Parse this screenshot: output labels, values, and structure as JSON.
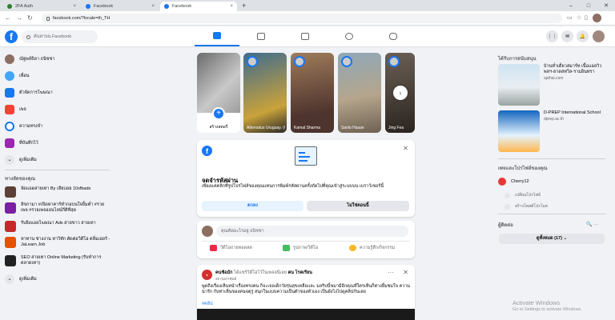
{
  "browser": {
    "tabs": [
      {
        "label": "2FA Auth"
      },
      {
        "label": "Facebook"
      },
      {
        "label": "Facebook"
      }
    ],
    "url": "facebook.com/?locale=th_TH",
    "new_tab": "+",
    "close": "×",
    "back": "←",
    "forward": "→",
    "reload": "↻",
    "minimize": "–",
    "maximize": "□",
    "win_close": "✕"
  },
  "header": {
    "logo": "f",
    "search_placeholder": "ค้นหาบน Facebook",
    "menu_icon": "⋮⋮",
    "messenger_icon": "✉",
    "bell_icon": "🔔"
  },
  "sidebar": {
    "items": [
      {
        "label": "ณัฐพล์ธิดา ธนิชชา"
      },
      {
        "label": "เพื่อน"
      },
      {
        "label": "ตัวจัดการโฆษณา"
      },
      {
        "label": "เพจ"
      },
      {
        "label": "ความทรงจำ"
      },
      {
        "label": "ที่บันทึกไว้"
      },
      {
        "label": "ดูเพิ่มเติม"
      }
    ],
    "shortcuts_title": "ทางลัดของคุณ",
    "shortcuts": [
      {
        "label": "จัดแอดสายเทา By เฮียบอย 10xfbads"
      },
      {
        "label": "ลิขกามา #เปิดหาคาร์ทำกอบนใจยิ้มต่ำ #รวยเพจ #รวยเพจออนไลน์กี่ดีที่สุด"
      },
      {
        "label": "รับยิงแอดโฆษณา Ads สายขาว สายเทา"
      },
      {
        "label": "หาทาน ช่างงาน หาวิทัก ตัดต่อวิดีโอ ตลิ่มเอยร์ - JaLearn Job"
      },
      {
        "label": "SEO สายเทา Online Marketing (รับทำการตลาดเทา)"
      },
      {
        "label": "ดูเพิ่มเติม"
      }
    ]
  },
  "stories": [
    {
      "label": "สร้างสตอรี่"
    },
    {
      "label": "Alternatus Uruguay. (Ciudad..."
    },
    {
      "label": "Kamal Sharma"
    },
    {
      "label": "Sanlo Hasan"
    },
    {
      "label": "Jing Fea"
    }
  ],
  "password_card": {
    "title": "จดจำรหัสผ่าน",
    "desc": "เพียงแค่คลิกที่รูปโปรไฟล์ของคุณแทนการพิมพ์รหัสผ่านครั้งถัดไปที่คุณเข้าสู่ระบบบน เบราว์เซอร์นี้",
    "ok": "ตกลง",
    "not_now": "ไม่ใช่ตอนนี้"
  },
  "composer": {
    "placeholder": "คุณคิดอะไรอยู่ ธนิชชา",
    "live": "วิดีโอถ่ายทอดสด",
    "photo": "รูปภาพ/วิดีโอ",
    "feeling": "ความรู้สึก/กิจกรรม"
  },
  "post": {
    "author": "คนซ้อมัก",
    "with_text": "ได้แชร์วิดีโอไว้ในเพจอนีเลย",
    "partner": "คน โรคเรียน",
    "time": "29 กุมภาพันธ์ ·",
    "more": "···",
    "text": "พูดถึงเรื่องเห็นหน้าเรื่องทรงคน ก็จะเจอเด็กวัยรุ่นสุขเหลือและ มลริบนี้ขมามีอีกคุณที่ใครเห็นก็ต่างยิ้มชมใจ ความน่ารัก กับท่าเห็นของคนจตุรู สนุกในแบบความเป็นตัวของตัวเอง เป็นยังไงไปดูคลิปกันเลย",
    "tag": "#คลิป"
  },
  "right": {
    "sponsored_title": "ได้รับการสนับสนุน",
    "ads": [
      {
        "title": "บ้านท่ำเดี่ยวสมาร์ท เนื้อแอลวิวพลฯ-ฮาดสทวิล-รามอินทรา",
        "url": "apthai.com"
      },
      {
        "title": "D-PREP International School",
        "url": "dprep.ac.th"
      }
    ],
    "pages_title": "เพจและโปรไฟล์ของคุณ",
    "page_name": "Cherry12",
    "page_action1": "เปลี่ยนโปรไฟล์",
    "page_action2": "สร้างโพสต์โปรโมท",
    "contacts_title": "ผู้ติดต่อ",
    "contacts_tools": "🔍  ···",
    "see_all": "ดูทั้งหมด (17)  ⌄"
  },
  "watermark": {
    "line1": "Activate Windows",
    "line2": "Go to Settings to activate Windows."
  },
  "colors": {
    "brand": "#1877f2",
    "background": "#f0f2f5"
  }
}
